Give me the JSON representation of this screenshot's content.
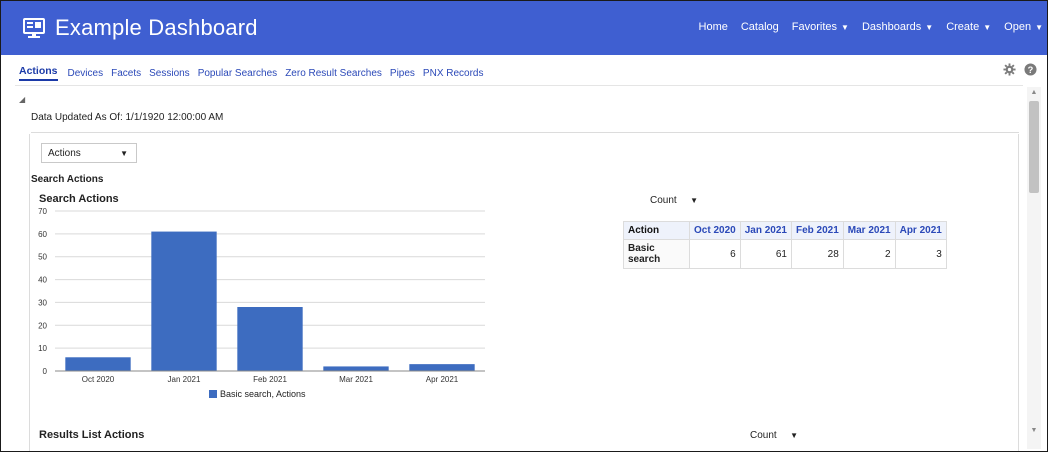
{
  "header": {
    "title": "Example Dashboard",
    "brand_icon": "monitor-icon",
    "nav": [
      {
        "label": "Home",
        "dropdown": false
      },
      {
        "label": "Catalog",
        "dropdown": false
      },
      {
        "label": "Favorites",
        "dropdown": true
      },
      {
        "label": "Dashboards",
        "dropdown": true
      },
      {
        "label": "Create",
        "dropdown": true
      },
      {
        "label": "Open",
        "dropdown": true
      }
    ],
    "dropdown_caret": "▼",
    "background_color": "#3f5fd1"
  },
  "tabs": [
    {
      "label": "Actions",
      "active": true
    },
    {
      "label": "Devices"
    },
    {
      "label": "Facets"
    },
    {
      "label": "Sessions"
    },
    {
      "label": "Popular Searches"
    },
    {
      "label": "Zero Result Searches"
    },
    {
      "label": "Pipes"
    },
    {
      "label": "PNX Records"
    }
  ],
  "tab_icons": [
    "gear-icon",
    "help-icon"
  ],
  "content": {
    "collapse_glyph": "◢",
    "updated_text": "Data Updated As Of: 1/1/1920 12:00:00 AM",
    "selector": {
      "value": "Actions"
    },
    "section_label": "Search Actions",
    "count_selector_1": {
      "value": "Count"
    },
    "results_label": "Results List Actions",
    "count_selector_2": {
      "value": "Count"
    }
  },
  "chart_data": {
    "type": "bar",
    "title": "Search Actions",
    "categories": [
      "Oct 2020",
      "Jan 2021",
      "Feb 2021",
      "Mar 2021",
      "Apr 2021"
    ],
    "series": [
      {
        "name": "Basic search, Actions",
        "values": [
          6,
          61,
          28,
          2,
          3
        ],
        "color": "#3d6cc0"
      }
    ],
    "ylim": [
      0,
      70
    ],
    "yticks": [
      0,
      10,
      20,
      30,
      40,
      50,
      60,
      70
    ],
    "grid": true,
    "legend": "bottom"
  },
  "table": {
    "row_header": "Action",
    "columns": [
      "Oct 2020",
      "Jan 2021",
      "Feb 2021",
      "Mar 2021",
      "Apr 2021"
    ],
    "rows": [
      {
        "label": "Basic search",
        "values": [
          "6",
          "61",
          "28",
          "2",
          "3"
        ]
      }
    ]
  }
}
